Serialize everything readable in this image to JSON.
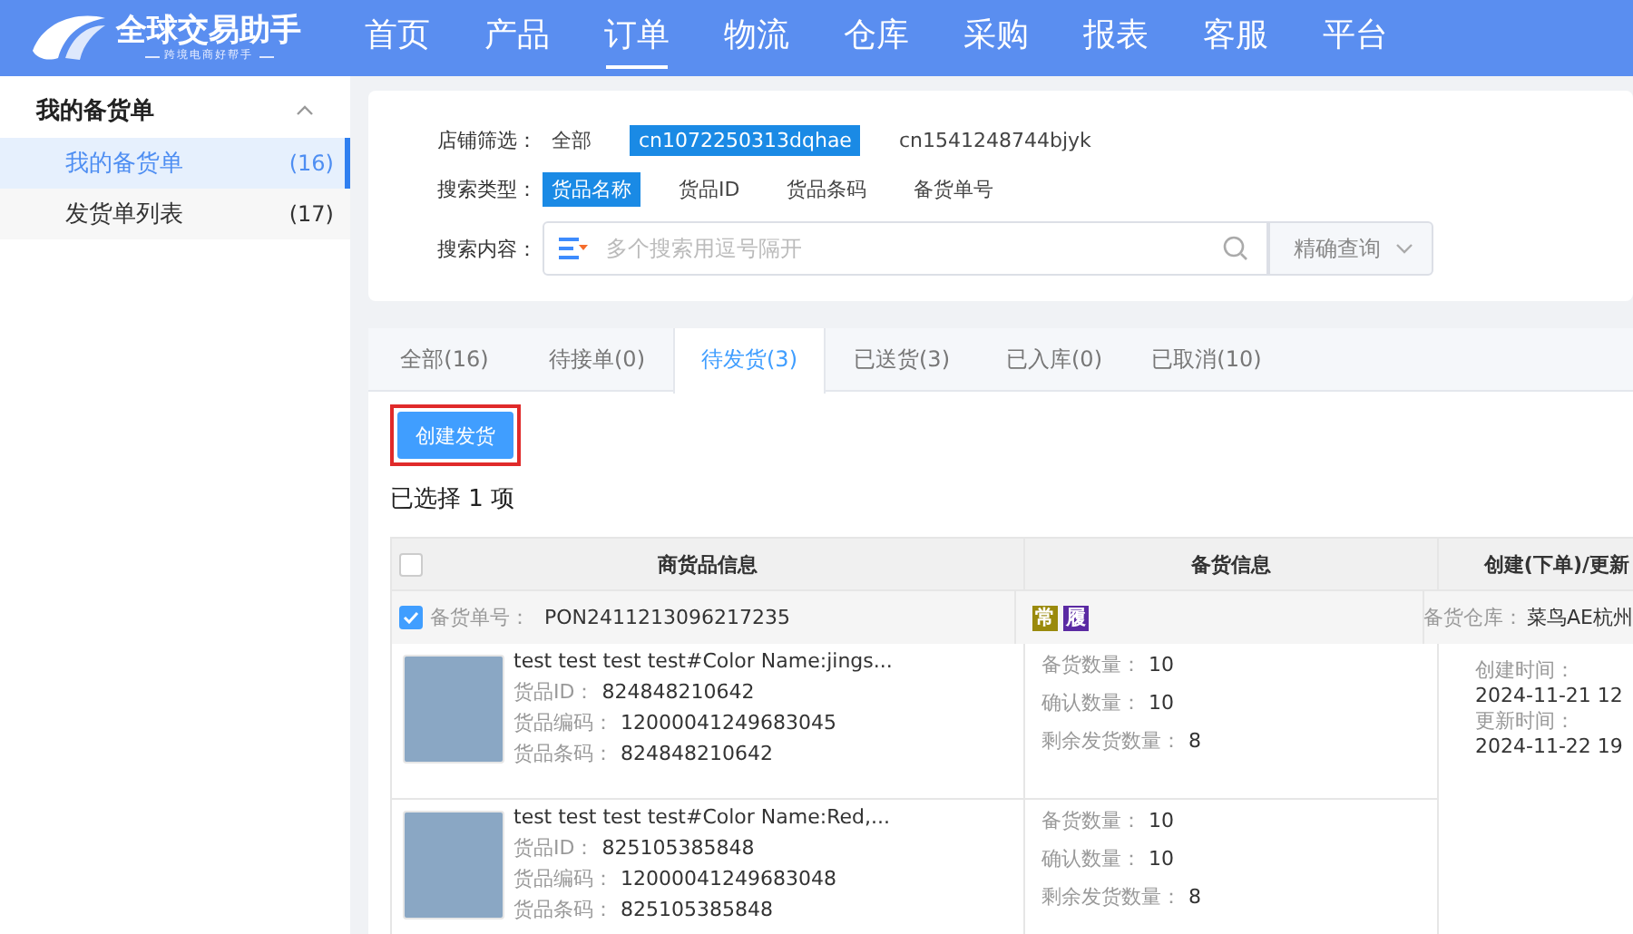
{
  "nav": {
    "logo": {
      "title": "全球交易助手",
      "subtitle": "跨境电商好帮手"
    },
    "items": [
      {
        "label": "首页",
        "selected": false
      },
      {
        "label": "产品",
        "selected": false
      },
      {
        "label": "订单",
        "selected": true
      },
      {
        "label": "物流",
        "selected": false
      },
      {
        "label": "仓库",
        "selected": false
      },
      {
        "label": "采购",
        "selected": false
      },
      {
        "label": "报表",
        "selected": false
      },
      {
        "label": "客服",
        "selected": false
      },
      {
        "label": "平台",
        "selected": false
      }
    ]
  },
  "sidebar": {
    "group": {
      "title": "我的备货单",
      "expanded": true
    },
    "items": [
      {
        "label": "我的备货单",
        "count": "(16)",
        "selected": true
      },
      {
        "label": "发货单列表",
        "count": "(17)",
        "selected": false
      }
    ]
  },
  "filters": [
    {
      "label": "店铺筛选：",
      "options": [
        {
          "label": "全部",
          "selected": false
        },
        {
          "label": "cn1072250313dqhae",
          "selected": true
        },
        {
          "label": "cn1541248744bjyk",
          "selected": false
        }
      ]
    },
    {
      "label": "搜索类型：",
      "options": [
        {
          "label": "货品名称",
          "selected": true
        },
        {
          "label": "货品ID",
          "selected": false
        },
        {
          "label": "货品条码",
          "selected": false
        },
        {
          "label": "备货单号",
          "selected": false
        }
      ]
    }
  ],
  "search": {
    "label": "搜索内容：",
    "placeholder": "多个搜索用逗号隔开",
    "mode": "精确查询"
  },
  "tabs": [
    {
      "label": "全部(16)",
      "selected": false
    },
    {
      "label": "待接单(0)",
      "selected": false
    },
    {
      "label": "待发货(3)",
      "selected": true
    },
    {
      "label": "已送货(3)",
      "selected": false
    },
    {
      "label": "已入库(0)",
      "selected": false
    },
    {
      "label": "已取消(10)",
      "selected": false
    }
  ],
  "create_button": "创建发货",
  "selection_note": "已选择 1 项",
  "table": {
    "columns": [
      "商货品信息",
      "备货信息",
      "创建(下单)/更新"
    ],
    "select_all": {
      "checked": false
    },
    "orders": [
      {
        "checked": true,
        "order_label": "备货单号：",
        "order_no": "PON2411213096217235",
        "tags": [
          {
            "text": "常",
            "color": "#9a8a0c"
          },
          {
            "text": "履",
            "color": "#5b2aa3"
          }
        ],
        "warehouse_label": "备货仓库：",
        "warehouse": "菜鸟AE杭州",
        "times": [
          {
            "label": "创建时间：",
            "value": "2024-11-21 12"
          },
          {
            "label": "更新时间：",
            "value": "2024-11-22 19"
          }
        ],
        "items": [
          {
            "title": "test test test test#Color Name:jings...",
            "fields": [
              {
                "label": "货品ID：",
                "value": "824848210642"
              },
              {
                "label": "货品编码：",
                "value": "12000041249683045"
              },
              {
                "label": "货品条码：",
                "value": "824848210642"
              }
            ],
            "stock": [
              {
                "label": "备货数量：",
                "value": "10"
              },
              {
                "label": "确认数量：",
                "value": "10"
              },
              {
                "label": "剩余发货数量：",
                "value": "8"
              }
            ]
          },
          {
            "title": "test test test test#Color Name:Red,...",
            "fields": [
              {
                "label": "货品ID：",
                "value": "825105385848"
              },
              {
                "label": "货品编码：",
                "value": "12000041249683048"
              },
              {
                "label": "货品条码：",
                "value": "825105385848"
              }
            ],
            "stock": [
              {
                "label": "备货数量：",
                "value": "10"
              },
              {
                "label": "确认数量：",
                "value": "10"
              },
              {
                "label": "剩余发货数量：",
                "value": "8"
              }
            ]
          }
        ]
      }
    ]
  }
}
